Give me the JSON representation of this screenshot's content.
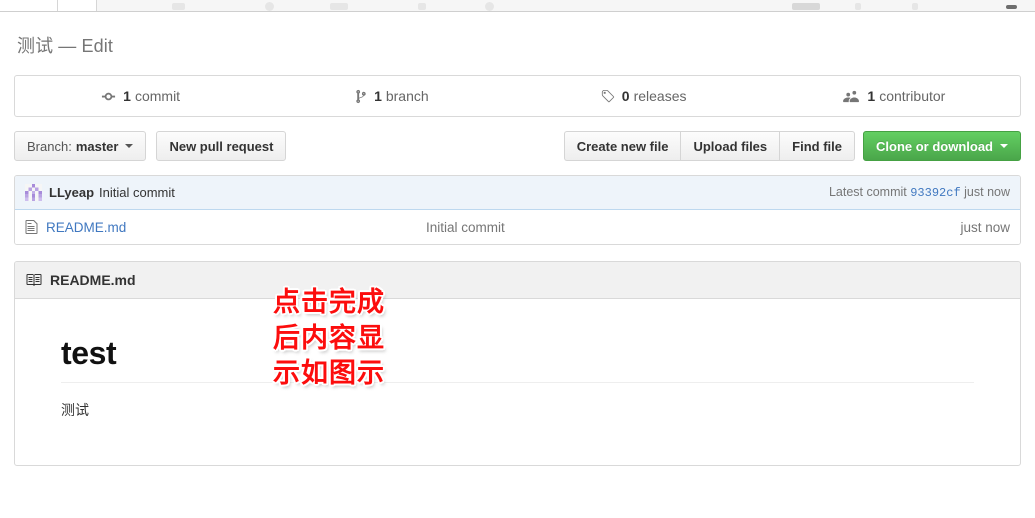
{
  "browser": {
    "tab_strip_label": "browser-tab-strip"
  },
  "page": {
    "title": "测试 — Edit"
  },
  "stats": [
    {
      "icon": "commit-icon",
      "num": "1",
      "label": "commit"
    },
    {
      "icon": "branch-icon",
      "num": "1",
      "label": "branch"
    },
    {
      "icon": "tag-icon",
      "num": "0",
      "label": "releases"
    },
    {
      "icon": "contributor-icon",
      "num": "1",
      "label": "contributor"
    }
  ],
  "toolbar": {
    "branch_prefix": "Branch:",
    "branch_name": "master",
    "new_pull_request": "New pull request",
    "create_new_file": "Create new file",
    "upload_files": "Upload files",
    "find_file": "Find file",
    "clone_or_download": "Clone or download"
  },
  "commit_bar": {
    "author": "LLyeap",
    "message": "Initial commit",
    "latest_commit_label": "Latest commit",
    "sha": "93392cf",
    "age": "just now"
  },
  "file_row": {
    "name": "README.md",
    "message": "Initial commit",
    "age": "just now"
  },
  "readme": {
    "header": "README.md",
    "heading": "test",
    "paragraph": "测试"
  },
  "annotation": {
    "line1": "点击完成",
    "line2": "后内容显",
    "line3": "示如图示"
  },
  "colors": {
    "link": "#4078c0",
    "green_button": "#4aa64a",
    "commit_bar_bg": "#eef4fa",
    "annotation_red": "#fc0d0d",
    "muted_text": "#767676"
  }
}
